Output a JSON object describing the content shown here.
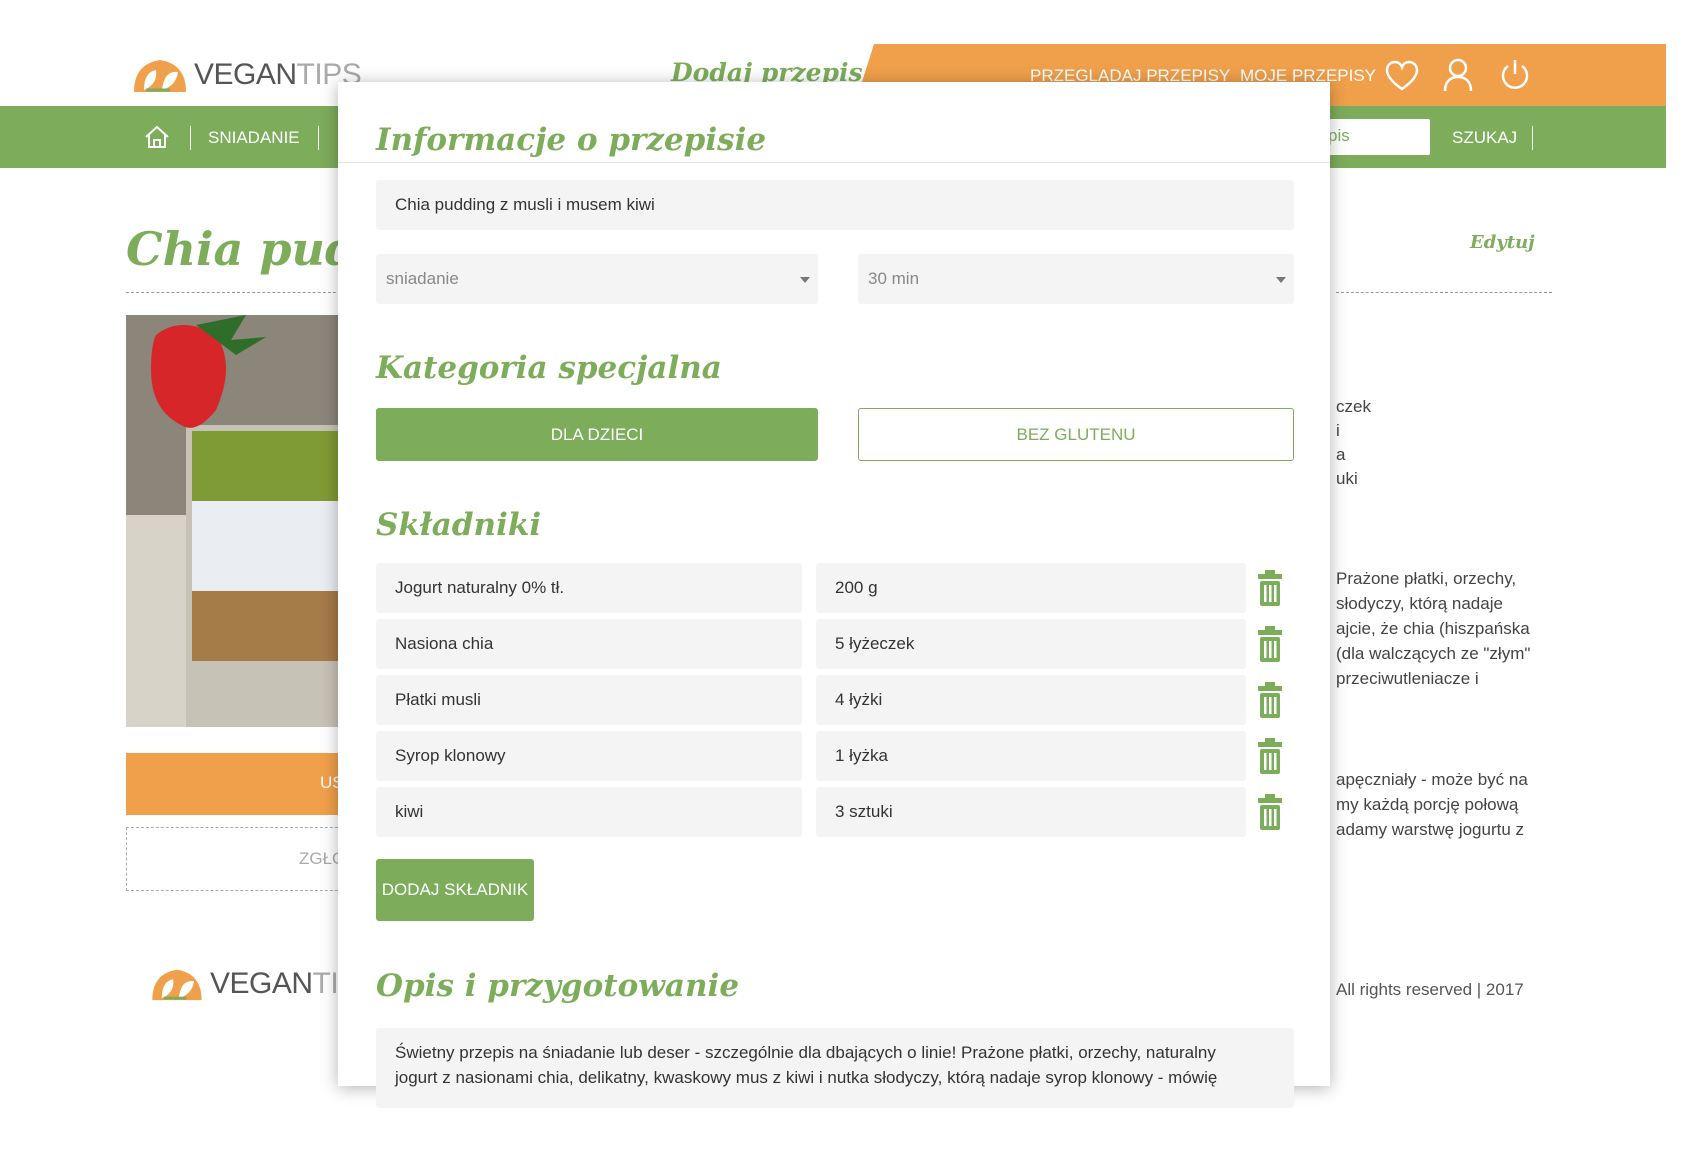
{
  "header": {
    "logo_part_1": "VEGAN",
    "logo_part_2": "TIPS",
    "add_recipe_link": "Dodaj przepis",
    "nav_browse": "PRZEGLADAJ PRZEPISY",
    "nav_my": "MOJE PRZEPISY",
    "icons": [
      "heart-icon",
      "user-icon",
      "power-icon"
    ]
  },
  "green_nav": {
    "items": [
      "SNIADANIE"
    ],
    "search_value_partial": "pis",
    "search_button": "SZUKAJ",
    "icons": [
      "home-icon"
    ]
  },
  "background_page": {
    "title_partial": "Chia pudd",
    "edit_link": "Edytuj",
    "orange_button_partial": "US",
    "report_button_partial": "ZGŁO",
    "ingredients_partial": [
      "czek",
      "i",
      "a",
      "uki"
    ],
    "description_partial_1": [
      "Prażone płatki, orzechy,",
      "słodyczy, którą nadaje",
      "ajcie, że chia (hiszpańska",
      "(dla walczących ze \"złym\"",
      "przeciwutleniacze i"
    ],
    "description_partial_2": [
      "apęczniały - może być na",
      "my każdą porcję połową",
      "adamy warstwę jogurtu z"
    ],
    "footer_logo_part_1": "VEGAN",
    "footer_logo_part_2": "TI",
    "footer_copyright_partial": "All rights reserved | 2017"
  },
  "modal": {
    "section_info": "Informacje o przepisie",
    "recipe_name": "Chia pudding z musli i musem kiwi",
    "meal_type": "sniadanie",
    "prep_time": "30 min",
    "section_category": "Kategoria specjalna",
    "category_kids": "DLA DZIECI",
    "category_gluten_free": "BEZ GLUTENU",
    "section_ingredients": "Składniki",
    "ingredients": [
      {
        "name": "Jogurt naturalny 0% tł.",
        "amount": "200 g"
      },
      {
        "name": "Nasiona chia",
        "amount": "5 łyżeczek"
      },
      {
        "name": "Płatki musli",
        "amount": "4 łyżki"
      },
      {
        "name": "Syrop klonowy",
        "amount": "1 łyżka"
      },
      {
        "name": "kiwi",
        "amount": "3 sztuki"
      }
    ],
    "add_ingredient": "DODAJ SKŁADNIK",
    "section_description": "Opis i przygotowanie",
    "description_line_1": "Świetny przepis na śniadanie lub deser - szczególnie dla dbających o linie! Prażone płatki, orzechy, naturalny",
    "description_line_2": "jogurt z nasionami chia, delikatny, kwaskowy mus z kiwi i nutka słodyczy, którą nadaje syrop klonowy - mówię",
    "trash_icon": "trash-icon"
  },
  "colors": {
    "green": "#7dad5b",
    "orange": "#f0a04b"
  }
}
